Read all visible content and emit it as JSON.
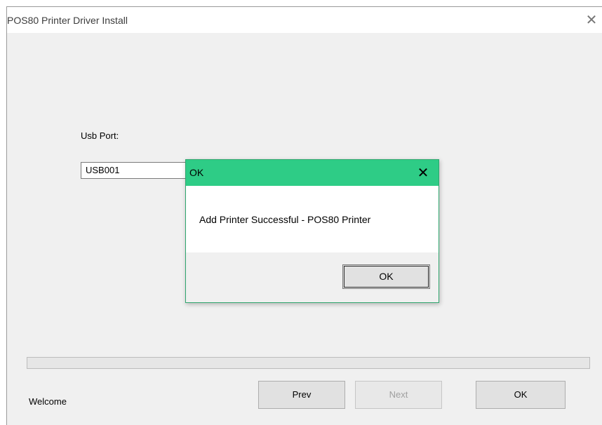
{
  "window": {
    "title": "POS80 Printer Driver Install",
    "close_glyph": "✕"
  },
  "form": {
    "usb_label": "Usb Port:",
    "usb_value": "USB001"
  },
  "progress": {
    "value": 0
  },
  "status": "Welcome",
  "buttons": {
    "prev": "Prev",
    "next": "Next",
    "ok": "OK"
  },
  "dialog": {
    "title": "OK",
    "close_glyph": "✕",
    "message": "Add Printer Successful - POS80 Printer",
    "ok_label": "OK"
  },
  "colors": {
    "dialog_titlebar": "#2ecc86",
    "progress_fill": "#06b025"
  }
}
